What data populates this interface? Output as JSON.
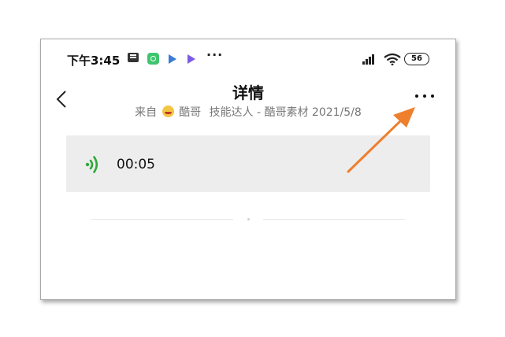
{
  "status_bar": {
    "time": "下午3:45",
    "overflow": "···",
    "battery": "56"
  },
  "header": {
    "title": "详情",
    "source_prefix": "来自",
    "author": "酷哥",
    "meta": "技能达人 - 酷哥素材 2021/5/8"
  },
  "voice_message": {
    "duration": "00:05"
  },
  "colors": {
    "voice_green": "#2fa83a",
    "annotation_arrow": "#ee7f2d",
    "card_bg": "#ededed"
  },
  "icons": [
    "back-icon",
    "more-icon",
    "voice-wave-icon",
    "wifi-icon",
    "signal-icon",
    "battery-icon"
  ]
}
